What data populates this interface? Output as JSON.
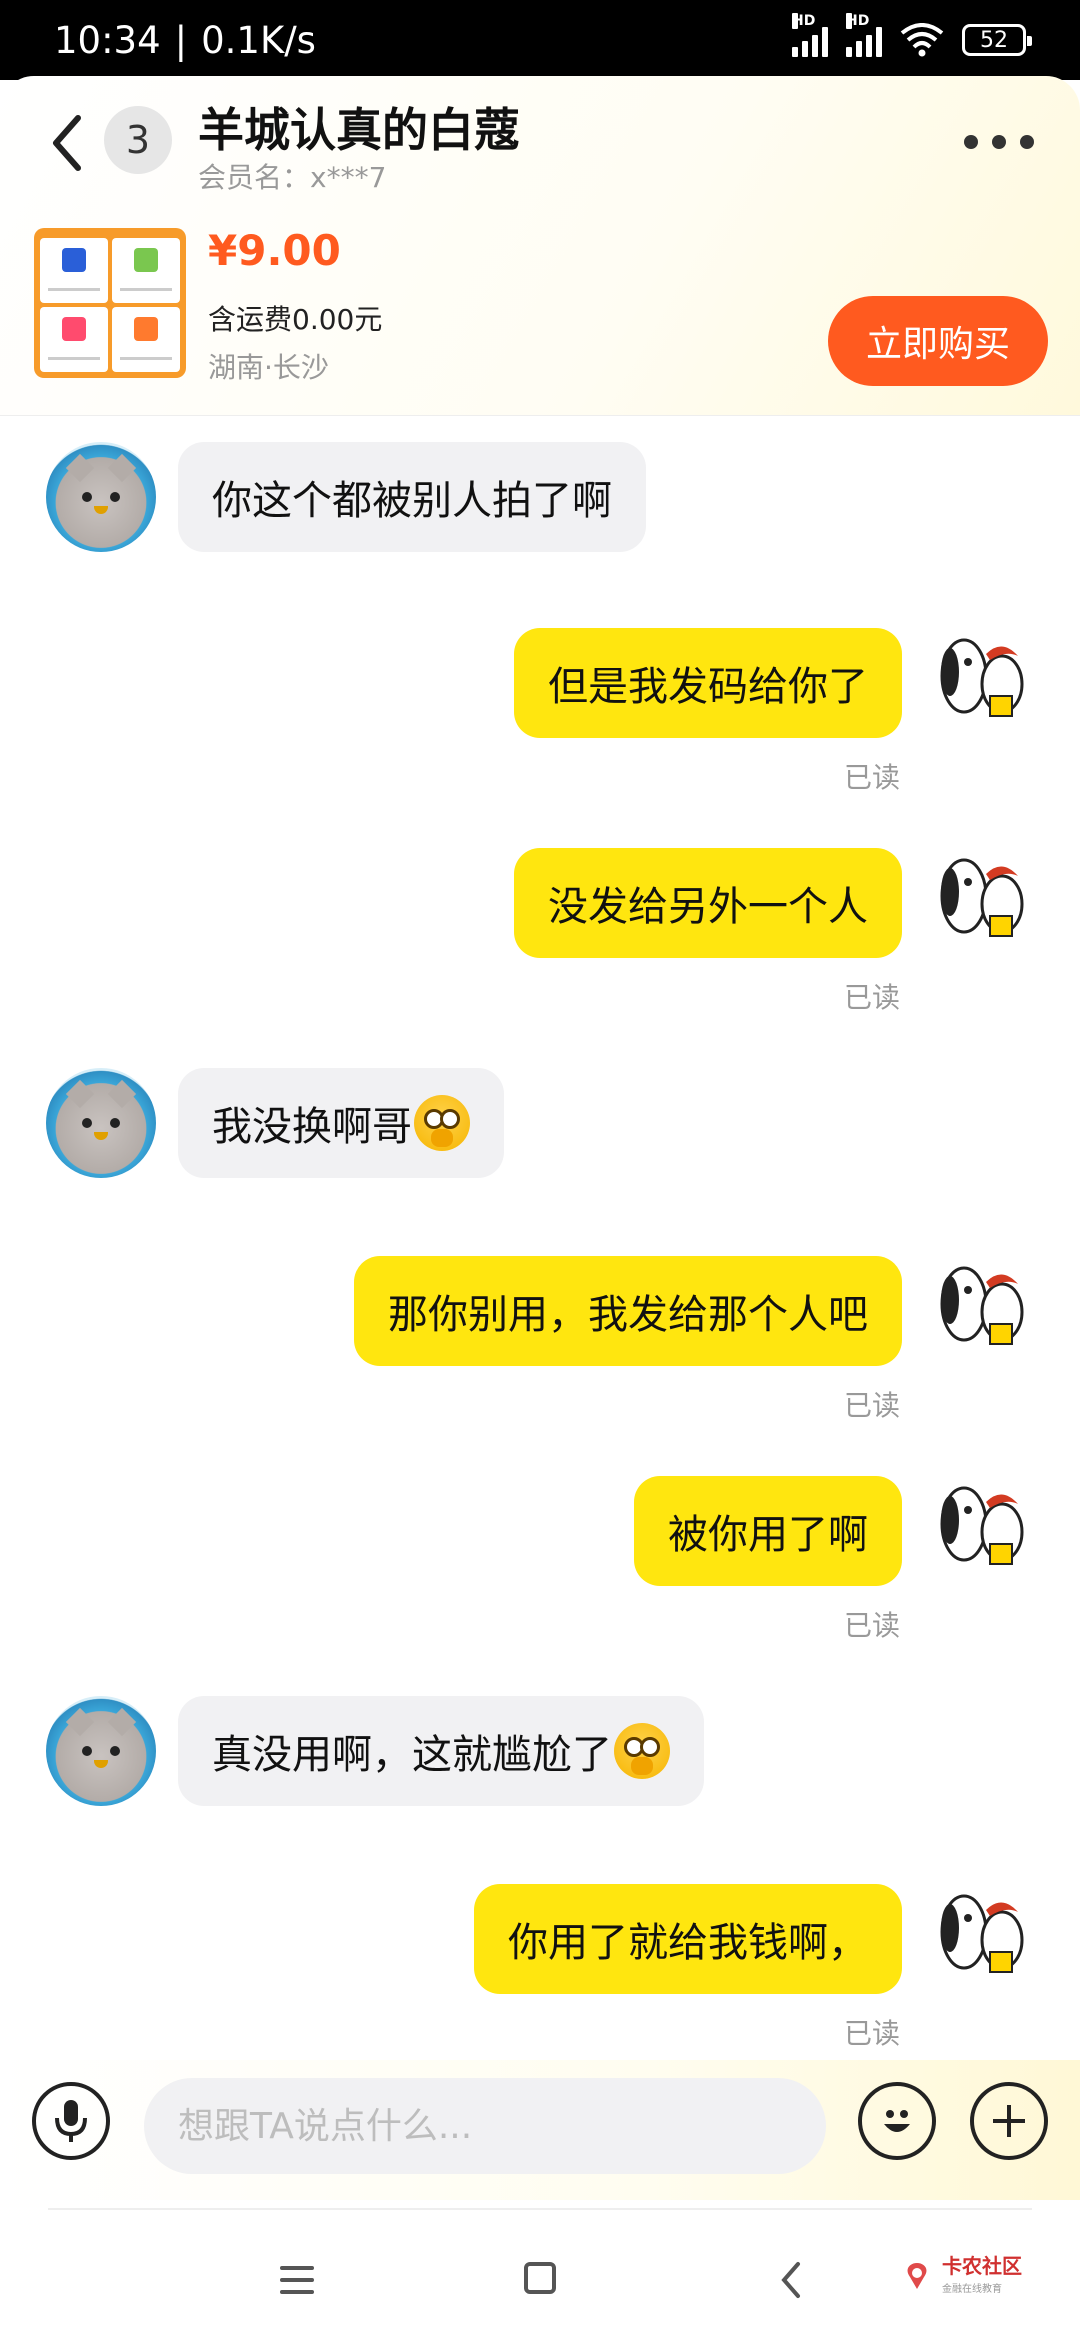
{
  "status_bar": {
    "time": "10:34",
    "speed": "0.1K/s",
    "hd1": "HD",
    "hd2": "HD",
    "battery": "52"
  },
  "header": {
    "unread_count": "3",
    "title": "羊城认真的白蔻",
    "member_name": "会员名：x***7"
  },
  "product": {
    "price": "¥9.00",
    "shipping": "含运费0.00元",
    "location": "湖南·长沙",
    "buy_label": "立即购买"
  },
  "messages": [
    {
      "side": "in",
      "text": "你这个都被别人拍了啊",
      "emoji": false
    },
    {
      "side": "out",
      "text": "但是我发码给你了",
      "read": "已读"
    },
    {
      "side": "out",
      "text": "没发给另外一个人",
      "read": "已读"
    },
    {
      "side": "in",
      "text": "我没换啊哥",
      "emoji": true
    },
    {
      "side": "out",
      "text": "那你别用，我发给那个人吧",
      "read": "已读"
    },
    {
      "side": "out",
      "text": "被你用了啊",
      "read": "已读"
    },
    {
      "side": "in",
      "text": "真没用啊，这就尴尬了",
      "emoji": true
    },
    {
      "side": "out",
      "text": "你用了就给我钱啊，",
      "read": "已读"
    }
  ],
  "input": {
    "placeholder": "想跟TA说点什么..."
  },
  "watermark": {
    "title": "卡农社区",
    "subtitle": "金融在线教育"
  },
  "icons": {
    "back": "back-chevron-icon",
    "more": "more-dots-icon",
    "voice": "microphone-icon",
    "emoji": "emoji-icon",
    "plus": "plus-icon"
  },
  "colors": {
    "accent": "#ff5a1f",
    "outgoing_bubble": "#ffe60f",
    "incoming_bubble": "#f1f1f3"
  }
}
